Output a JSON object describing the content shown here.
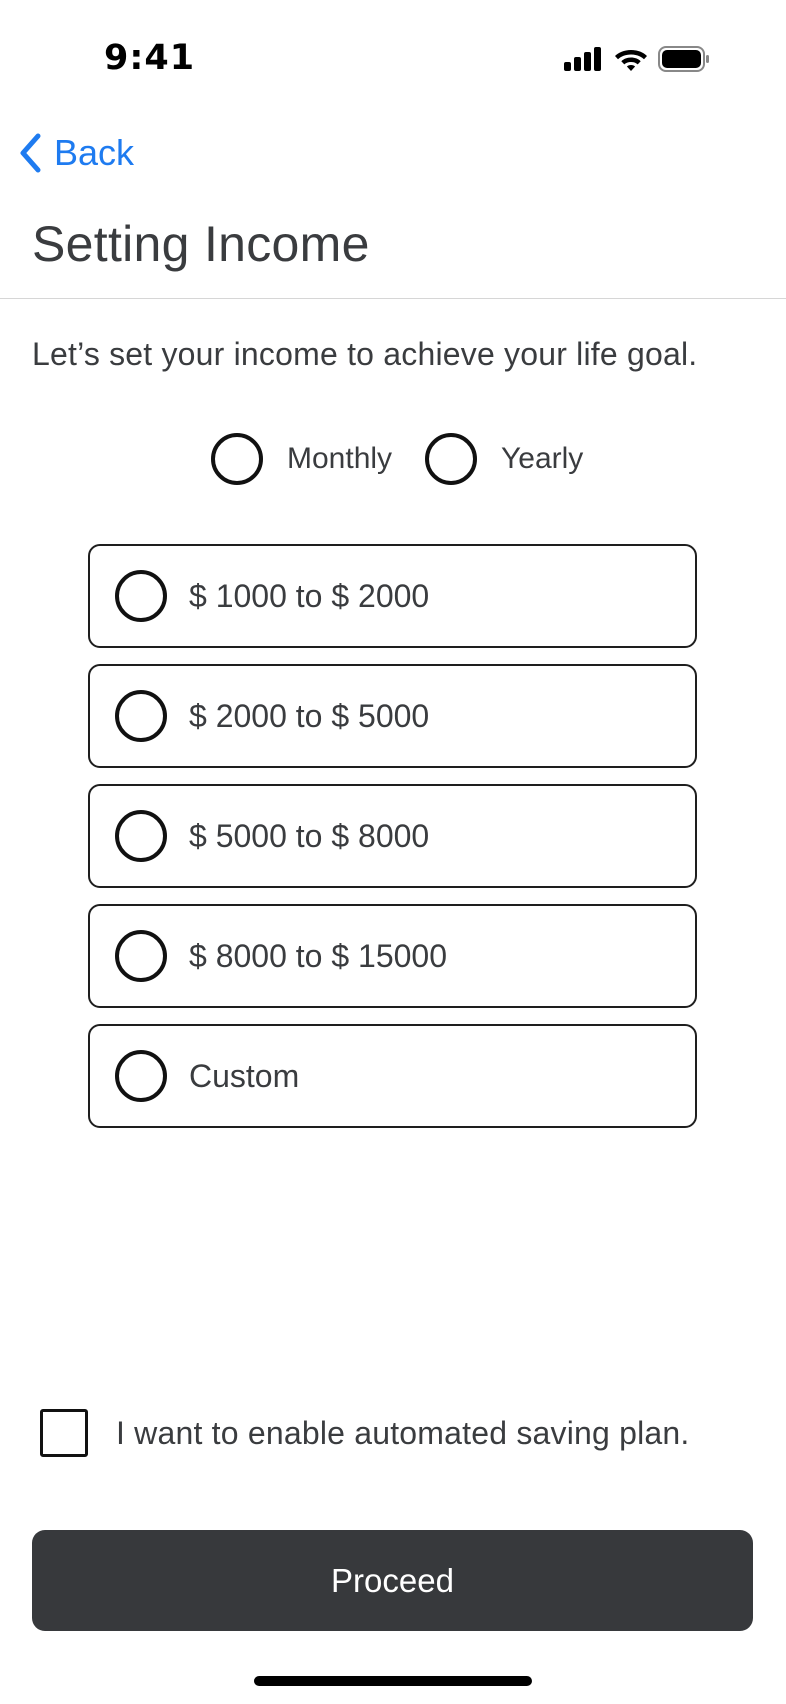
{
  "status_bar": {
    "time": "9:41",
    "icons": [
      "cellular-signal-icon",
      "wifi-icon",
      "battery-icon"
    ]
  },
  "nav": {
    "back_label": "Back",
    "title": "Setting Income"
  },
  "subtitle": "Let’s set your income to achieve your life goal.",
  "period": {
    "monthly_label": "Monthly",
    "yearly_label": "Yearly",
    "selected": null
  },
  "options": [
    {
      "label": "$ 1000 to $ 2000"
    },
    {
      "label": "$ 2000 to $ 5000"
    },
    {
      "label": "$ 5000 to $ 8000"
    },
    {
      "label": "$ 8000 to $ 15000"
    },
    {
      "label": "Custom"
    }
  ],
  "automated_saving": {
    "label": "I want to enable automated saving plan.",
    "checked": false
  },
  "proceed_label": "Proceed",
  "colors": {
    "accent": "#1e7bf0",
    "button_bg": "#37393c",
    "text": "#3a3c3f"
  }
}
